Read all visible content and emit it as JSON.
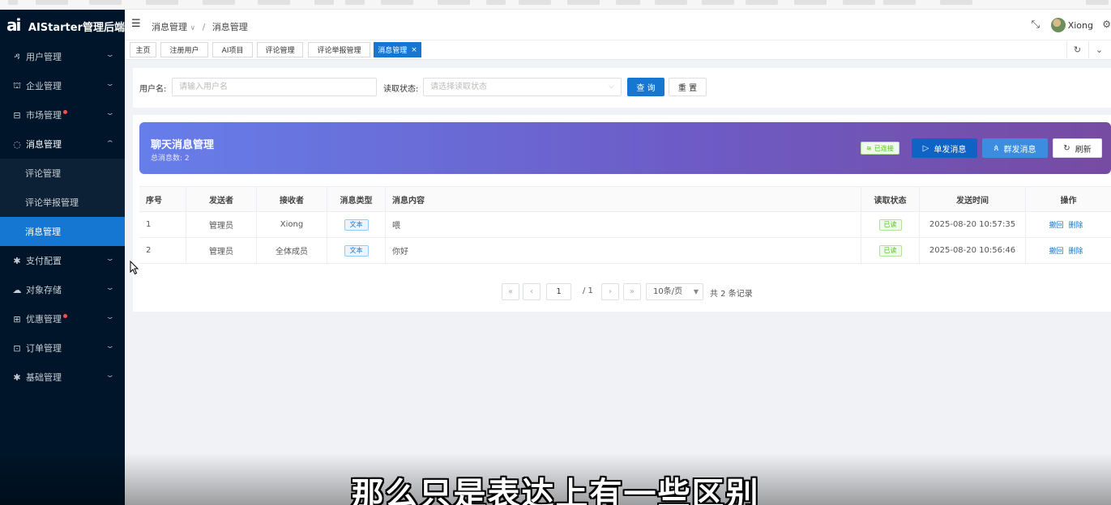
{
  "app": {
    "title": "AIStarter管理后端",
    "logo_glyph": "ai"
  },
  "sidebar": {
    "items": [
      {
        "label": "用户管理",
        "icon": "user-icon",
        "glyph": "ዳ",
        "dot": false
      },
      {
        "label": "企业管理",
        "icon": "bank-icon",
        "glyph": "⛫",
        "dot": false
      },
      {
        "label": "市场管理",
        "icon": "store-icon",
        "glyph": "⊟",
        "dot": true
      },
      {
        "label": "消息管理",
        "icon": "message-icon",
        "glyph": "◌",
        "dot": false,
        "open": true
      },
      {
        "label": "支付配置",
        "icon": "settings-icon",
        "glyph": "✱",
        "dot": false
      },
      {
        "label": "对象存储",
        "icon": "cloud-upload-icon",
        "glyph": "☁",
        "dot": false
      },
      {
        "label": "优惠管理",
        "icon": "gift-icon",
        "glyph": "⊞",
        "dot": true
      },
      {
        "label": "订单管理",
        "icon": "order-icon",
        "glyph": "⊡",
        "dot": false
      },
      {
        "label": "基础管理",
        "icon": "gear-icon",
        "glyph": "✱",
        "dot": false
      }
    ],
    "subitems": [
      "评论管理",
      "评论举报管理",
      "消息管理"
    ]
  },
  "header": {
    "breadcrumb": [
      "消息管理",
      "消息管理"
    ],
    "breadcrumb_caret": "∨",
    "breadcrumb_sep": "/",
    "username": "Xiong"
  },
  "tags": [
    {
      "label": "主页",
      "active": false
    },
    {
      "label": "注册用户",
      "active": false
    },
    {
      "label": "AI项目",
      "active": false
    },
    {
      "label": "评论管理",
      "active": false
    },
    {
      "label": "评论举报管理",
      "active": false
    },
    {
      "label": "消息管理",
      "active": true,
      "close": "×"
    }
  ],
  "search": {
    "username_label": "用户名:",
    "username_placeholder": "请输入用户名",
    "status_label": "读取状态:",
    "status_placeholder": "请选择读取状态",
    "query_button": "查 询",
    "reset_button": "重 置"
  },
  "banner": {
    "title": "聊天消息管理",
    "subtitle": "总消息数: 2",
    "connected_label": "已连接",
    "single_send": "单发消息",
    "group_send": "群发消息",
    "refresh": "刷新"
  },
  "table": {
    "columns": [
      "序号",
      "发送者",
      "接收者",
      "消息类型",
      "消息内容",
      "读取状态",
      "发送时间",
      "操作"
    ],
    "rows": [
      {
        "index": "1",
        "sender": "管理员",
        "receiver": "Xiong",
        "type": "文本",
        "content": "喂",
        "status": "已读",
        "time": "2025-08-20 10:57:35"
      },
      {
        "index": "2",
        "sender": "管理员",
        "receiver": "全体成员",
        "type": "文本",
        "content": "你好",
        "status": "已读",
        "time": "2025-08-20 10:56:46"
      }
    ],
    "actions": {
      "revoke": "撤回",
      "delete": "删除"
    }
  },
  "pagination": {
    "current_page": "1",
    "total_pages": "/ 1",
    "page_size": "10条/页",
    "total_text": "共 2 条记录"
  },
  "caption": "那么只是表达上有一些区别",
  "colors": {
    "primary": "#1677d2",
    "sidebar_bg": "#001529",
    "banner_start": "#667eea",
    "banner_end": "#764ba2",
    "success": "#52c41a",
    "danger": "#ff4d4f"
  }
}
